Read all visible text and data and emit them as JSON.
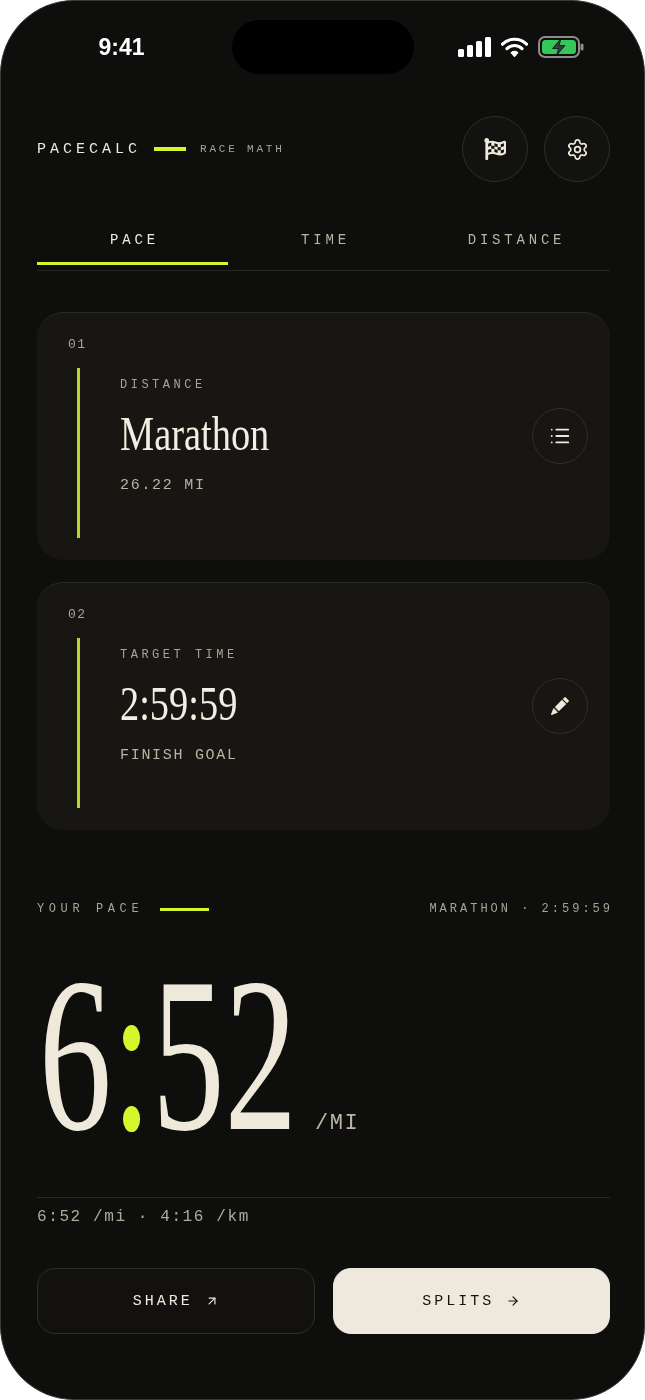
{
  "status_bar": {
    "time": "9:41"
  },
  "header": {
    "brand": "PACECALC",
    "tagline": "RACE MATH"
  },
  "tabs": [
    {
      "label": "PACE",
      "selected": true
    },
    {
      "label": "TIME",
      "selected": false
    },
    {
      "label": "DISTANCE",
      "selected": false
    }
  ],
  "inputs": [
    {
      "kind": "distance",
      "index": "01",
      "label": "DISTANCE",
      "value": "Marathon",
      "detail": "26.22 MI"
    },
    {
      "kind": "time",
      "index": "02",
      "label": "TARGET TIME",
      "value": "2:59:59",
      "detail": "FINISH GOAL"
    }
  ],
  "result": {
    "label": "YOUR PACE",
    "summary": "MARATHON · 2:59:59",
    "minutes": "6",
    "separator": ":",
    "seconds": "52",
    "unit": "/MI",
    "conversion": "6:52 /mi · 4:16 /km"
  },
  "buttons": [
    {
      "kind": "secondary",
      "label": "SHARE"
    },
    {
      "kind": "primary",
      "label": "SPLITS"
    }
  ]
}
